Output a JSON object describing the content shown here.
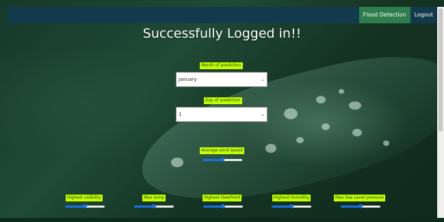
{
  "nav": {
    "flood_detection": "Flood Detection",
    "logout": "Logout"
  },
  "heading": "Successfully Logged in!!",
  "month": {
    "label": "Month of prediction",
    "value": "January"
  },
  "day": {
    "label": "Day of prediction",
    "value": "1"
  },
  "wind": {
    "label": "Average wind speed",
    "level": 0.5
  },
  "sliders": [
    {
      "label": "Highest visibility",
      "level": 0.5
    },
    {
      "label": "Max temp",
      "level": 0.5
    },
    {
      "label": "Highest DewPoint",
      "level": 0.5
    },
    {
      "label": "Highest Humidity",
      "level": 0.5
    },
    {
      "label": "Max Sea Level pressure",
      "level": 0.5
    }
  ],
  "colors": {
    "navbar": "#123a4c",
    "active_nav": "#2e7d4d",
    "label_bg": "#c4ff00",
    "slider": "#1a73e8"
  }
}
